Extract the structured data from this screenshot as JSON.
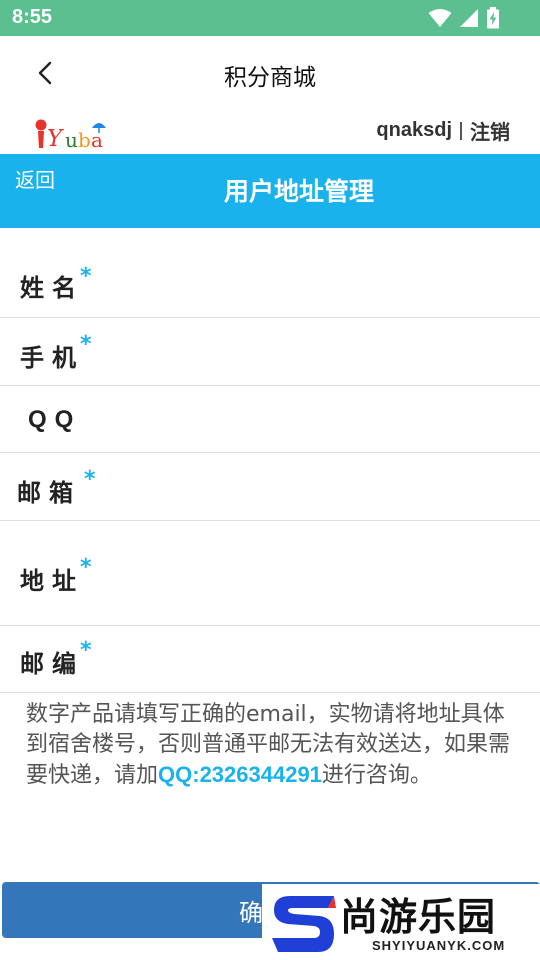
{
  "status_bar": {
    "time": "8:55"
  },
  "header": {
    "title": "积分商城"
  },
  "brand": {
    "logo_text": "iYuba",
    "username": "qnaksdj",
    "logout": "注销"
  },
  "banner": {
    "back": "返回",
    "title": "用户地址管理"
  },
  "form": {
    "fields": [
      {
        "label": "姓名",
        "required": "*"
      },
      {
        "label": "手机",
        "required": "*"
      },
      {
        "label": "QQ"
      },
      {
        "label": "邮箱",
        "required": "*"
      },
      {
        "label": "地址",
        "required": "*"
      },
      {
        "label": "邮编",
        "required": "*"
      }
    ]
  },
  "note": {
    "text_before": "数字产品请填写正确的email，实物请将地址具体到宿舍楼号，否则普通平邮无法有效送达，如果需要快递，请加",
    "qq": "QQ:2326344291",
    "text_after": "进行咨询。"
  },
  "confirm": {
    "label": "确"
  },
  "watermark": {
    "text": "尚游乐园",
    "domain": "SHYIYUANYK.COM"
  },
  "colors": {
    "status_bar": "#5bbf8f",
    "banner": "#1ab2ec",
    "button": "#3476ba",
    "accent": "#1ab2ec"
  }
}
